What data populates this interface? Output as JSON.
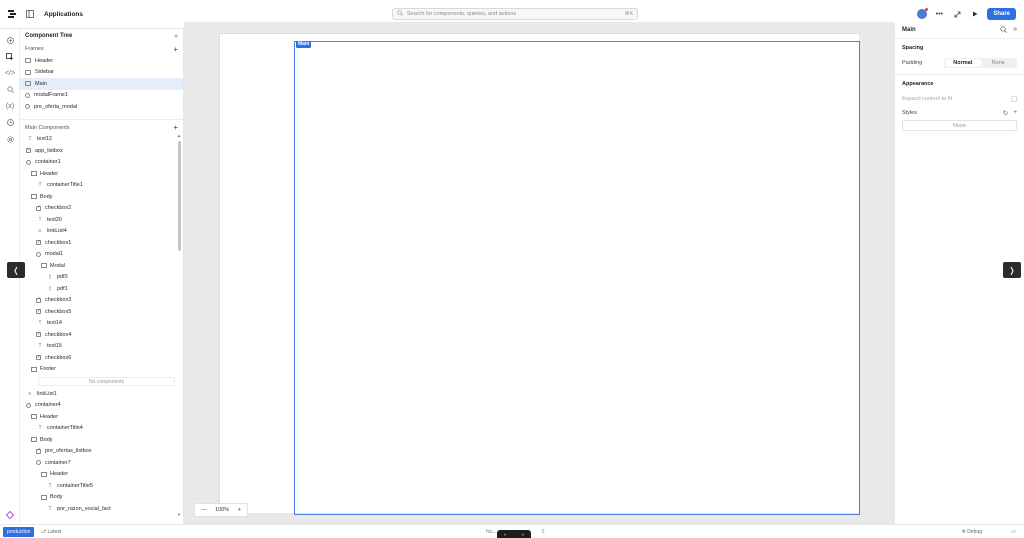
{
  "topbar": {
    "app_title": "Applications",
    "search_placeholder": "Search for components, queries, and actions",
    "search_shortcut": "⌘K",
    "share_label": "Share"
  },
  "tree": {
    "title": "Component Tree",
    "frames_label": "Frames",
    "frames": [
      "Header",
      "Sidebar",
      "Main",
      "modalFrame1",
      "pre_oferta_modal"
    ],
    "selected_frame": "Main",
    "main_components_label": "Main Components",
    "items": [
      {
        "label": "text12",
        "icon": "text-icon",
        "depth": 0
      },
      {
        "label": "app_listbox",
        "icon": "listbox-icon",
        "depth": 0
      },
      {
        "label": "container1",
        "icon": "container-icon",
        "depth": 0
      },
      {
        "label": "Header",
        "icon": "section-icon",
        "depth": 1
      },
      {
        "label": "containerTitle1",
        "icon": "text-icon",
        "depth": 2
      },
      {
        "label": "Body",
        "icon": "section-icon",
        "depth": 1
      },
      {
        "label": "checkbox2",
        "icon": "checkbox-icon",
        "depth": 2
      },
      {
        "label": "text20",
        "icon": "text-icon",
        "depth": 2
      },
      {
        "label": "linkList4",
        "icon": "list-icon",
        "depth": 2
      },
      {
        "label": "checkbox1",
        "icon": "checkbox-icon",
        "depth": 2
      },
      {
        "label": "modal1",
        "icon": "modal-icon",
        "depth": 2
      },
      {
        "label": "Modal",
        "icon": "section-icon",
        "depth": 3
      },
      {
        "label": "pdf3",
        "icon": "pdf-icon",
        "depth": 4
      },
      {
        "label": "pdf1",
        "icon": "pdf-icon",
        "depth": 4
      },
      {
        "label": "checkbox3",
        "icon": "checkbox-icon",
        "depth": 2
      },
      {
        "label": "checkbox5",
        "icon": "checkbox-icon",
        "depth": 2
      },
      {
        "label": "text14",
        "icon": "text-icon",
        "depth": 2
      },
      {
        "label": "checkbox4",
        "icon": "checkbox-icon",
        "depth": 2
      },
      {
        "label": "text15",
        "icon": "text-icon",
        "depth": 2
      },
      {
        "label": "checkbox6",
        "icon": "checkbox-icon",
        "depth": 2
      },
      {
        "label": "Footer",
        "icon": "section-icon",
        "depth": 1
      },
      {
        "label": "No components",
        "icon": "none",
        "depth": -1
      },
      {
        "label": "linkList1",
        "icon": "list-icon",
        "depth": 0
      },
      {
        "label": "container4",
        "icon": "container-icon",
        "depth": 0
      },
      {
        "label": "Header",
        "icon": "section-icon",
        "depth": 1
      },
      {
        "label": "containerTitle4",
        "icon": "text-icon",
        "depth": 2
      },
      {
        "label": "Body",
        "icon": "section-icon",
        "depth": 1
      },
      {
        "label": "pre_ofertas_listbox",
        "icon": "listbox-icon",
        "depth": 2
      },
      {
        "label": "container7",
        "icon": "container-icon",
        "depth": 2
      },
      {
        "label": "Header",
        "icon": "section-icon",
        "depth": 3
      },
      {
        "label": "containerTitle5",
        "icon": "text-icon",
        "depth": 4
      },
      {
        "label": "Body",
        "icon": "section-icon",
        "depth": 3
      },
      {
        "label": "por_razon_social_fact",
        "icon": "text-icon",
        "depth": 4
      }
    ]
  },
  "canvas": {
    "main_tag": "Main",
    "zoom": "100%"
  },
  "inspector": {
    "title": "Main",
    "spacing_label": "Spacing",
    "padding_label": "Padding",
    "padding_options": [
      "Normal",
      "None"
    ],
    "padding_selected": "Normal",
    "appearance_label": "Appearance",
    "expand_label": "Expand content to fit",
    "styles_label": "Styles",
    "styles_value": "None"
  },
  "bottombar": {
    "env": "production",
    "latest": "Latest",
    "center_status": "No...",
    "center_status_tail": "0",
    "debug": "Debug"
  },
  "colors": {
    "accent": "#2f6fe0",
    "selection": "#e4eefb"
  }
}
